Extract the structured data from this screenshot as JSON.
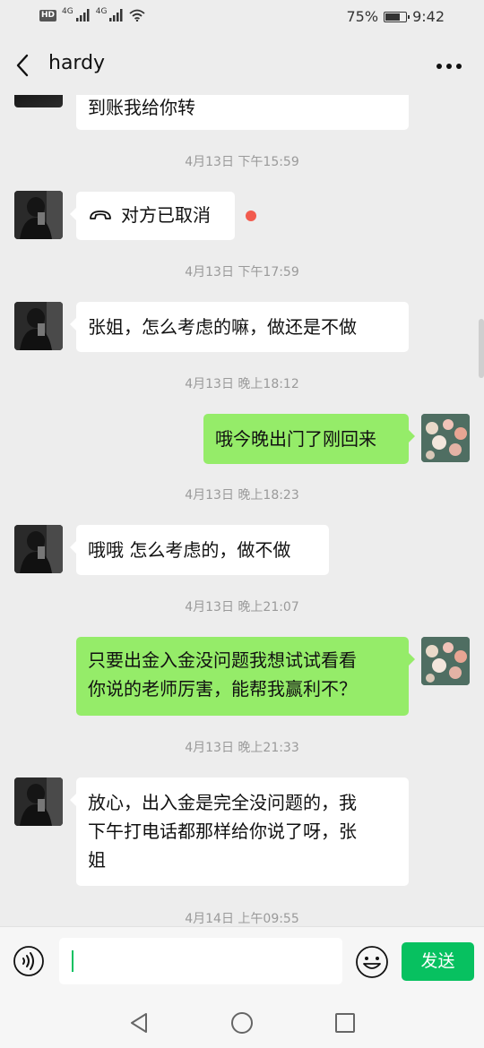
{
  "status_bar": {
    "hd_label": "HD",
    "network_1": "4G",
    "network_2": "4G",
    "battery_percent": "75%",
    "battery_level": 0.75,
    "time": "9:42"
  },
  "header": {
    "title": "hardy"
  },
  "messages": [
    {
      "kind": "text",
      "sender": "other",
      "text": "到账我给你转"
    },
    {
      "kind": "timestamp",
      "text": "4月13日 下午15:59"
    },
    {
      "kind": "call",
      "sender": "other",
      "text": "对方已取消",
      "unread": true
    },
    {
      "kind": "timestamp",
      "text": "4月13日 下午17:59"
    },
    {
      "kind": "text",
      "sender": "other",
      "text": "张姐，怎么考虑的嘛，做还是不做"
    },
    {
      "kind": "timestamp",
      "text": "4月13日 晚上18:12"
    },
    {
      "kind": "text",
      "sender": "self",
      "text": "哦今晚出门了刚回来"
    },
    {
      "kind": "timestamp",
      "text": "4月13日 晚上18:23"
    },
    {
      "kind": "text",
      "sender": "other",
      "text": "哦哦 怎么考虑的，做不做"
    },
    {
      "kind": "timestamp",
      "text": "4月13日 晚上21:07"
    },
    {
      "kind": "text",
      "sender": "self",
      "lines": [
        "只要出金入金没问题我想试试看看",
        "你说的老师厉害，能帮我赢利不？"
      ]
    },
    {
      "kind": "timestamp",
      "text": "4月13日 晚上21:33"
    },
    {
      "kind": "text",
      "sender": "other",
      "lines": [
        "放心，出入金是完全没问题的，我",
        "下午打电话都那样给你说了呀，张",
        "姐"
      ]
    },
    {
      "kind": "timestamp",
      "text": "4月14日 上午09:55"
    }
  ],
  "input_bar": {
    "input_value": "",
    "send_label": "发送"
  },
  "icons": {
    "back": "chevron-left-icon",
    "more": "more-dots-icon",
    "call": "phone-hangup-icon",
    "voice": "voice-icon",
    "emoji": "emoji-icon",
    "nav_back": "triangle-back-icon",
    "nav_home": "circle-home-icon",
    "nav_recent": "square-recent-icon"
  },
  "colors": {
    "background": "#ededed",
    "incoming_bubble": "#ffffff",
    "outgoing_bubble": "#95ec69",
    "accent": "#07c160",
    "unread_dot": "#f25b4e"
  }
}
